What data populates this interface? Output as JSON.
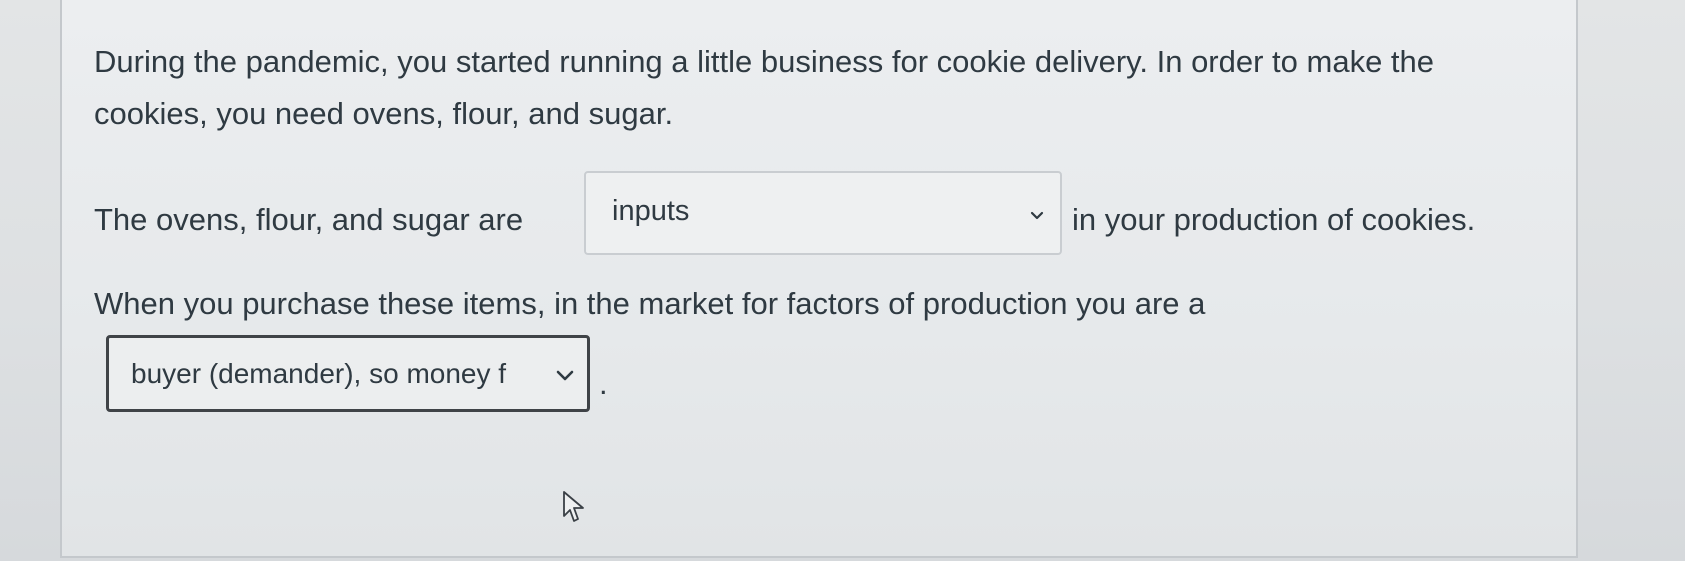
{
  "question": {
    "paragraph_intro": "During the pandemic, you started running a little business for cookie delivery. In order to make the cookies, you need ovens, flour, and sugar.",
    "sentence2_before": "The ovens, flour, and sugar are",
    "sentence2_after": "in your production of cookies.",
    "sentence3": "When you purchase these items, in the market for factors of production you are a",
    "sentence3_end": "."
  },
  "dropdowns": {
    "inputs": {
      "selected": "inputs",
      "icon": "chevron-down-icon"
    },
    "buyer": {
      "selected": "buyer (demander), so money f",
      "icon": "chevron-down-icon"
    }
  },
  "cursor": {
    "icon": "mouse-pointer-icon"
  },
  "colors": {
    "text": "#2f3a42",
    "card_border": "#c4c8cc",
    "focused_border": "#3f4347"
  }
}
